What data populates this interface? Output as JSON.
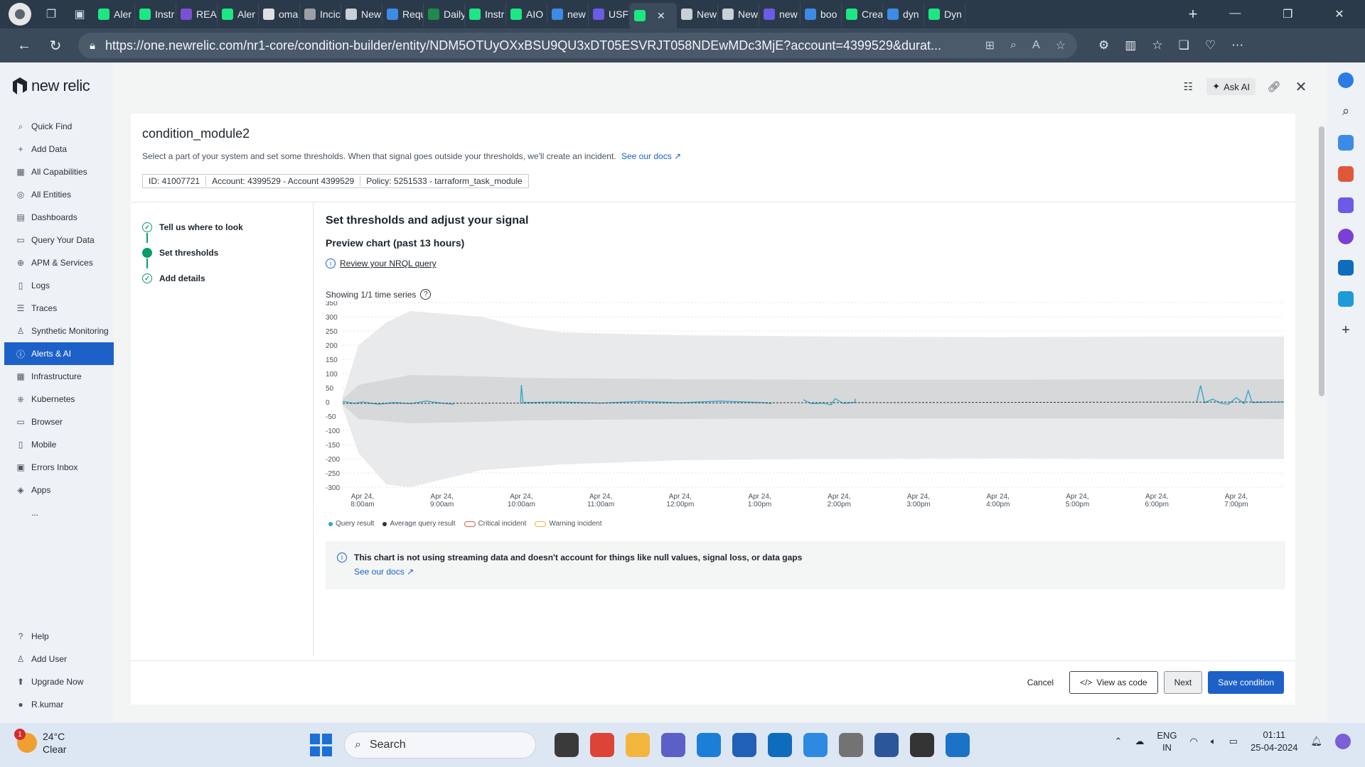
{
  "browser": {
    "tabs": [
      {
        "label": "Aler",
        "color": "#1ce783"
      },
      {
        "label": "Instr",
        "color": "#1ce783"
      },
      {
        "label": "REA",
        "color": "#7b4fd6"
      },
      {
        "label": "Aler",
        "color": "#1ce783"
      },
      {
        "label": "oma",
        "color": "#e0e0e0"
      },
      {
        "label": "Incic",
        "color": "#9aa0a6"
      },
      {
        "label": "New",
        "color": "#c9d0d6"
      },
      {
        "label": "Requ",
        "color": "#3c8ce7"
      },
      {
        "label": "Daily",
        "color": "#1e8a4c"
      },
      {
        "label": "Instr",
        "color": "#1ce783"
      },
      {
        "label": "AIO",
        "color": "#1ce783"
      },
      {
        "label": "new",
        "color": "#3c8ce7"
      },
      {
        "label": "USF",
        "color": "#6b5be6"
      },
      {
        "label": "",
        "color": "#1ce783",
        "active": true
      },
      {
        "label": "New",
        "color": "#c9d0d6"
      },
      {
        "label": "New",
        "color": "#c9d0d6"
      },
      {
        "label": "new",
        "color": "#6b5be6"
      },
      {
        "label": "boo",
        "color": "#3c8ce7"
      },
      {
        "label": "Crea",
        "color": "#1ce783"
      },
      {
        "label": "dyn",
        "color": "#3c8ce7"
      },
      {
        "label": "Dyn",
        "color": "#1ce783"
      }
    ],
    "url": "https://one.newrelic.com/nr1-core/condition-builder/entity/NDM5OTUyOXxBSU9QU3xDT05ESVRJT058NDEwMDc3MjE?account=4399529&durat..."
  },
  "nav": {
    "brand": "new relic",
    "items": [
      {
        "label": "Quick Find",
        "icon": "search-icon",
        "glyph": "⌕"
      },
      {
        "label": "Add Data",
        "icon": "plus-icon",
        "glyph": "+"
      },
      {
        "label": "All Capabilities",
        "icon": "grid-icon",
        "glyph": "▦"
      },
      {
        "label": "All Entities",
        "icon": "entities-icon",
        "glyph": "◎"
      },
      {
        "label": "Dashboards",
        "icon": "dashboard-icon",
        "glyph": "▤"
      },
      {
        "label": "Query Your Data",
        "icon": "query-icon",
        "glyph": "▭"
      },
      {
        "label": "APM & Services",
        "icon": "globe-icon",
        "glyph": "⊕"
      },
      {
        "label": "Logs",
        "icon": "logs-icon",
        "glyph": "▯"
      },
      {
        "label": "Traces",
        "icon": "traces-icon",
        "glyph": "☰"
      },
      {
        "label": "Synthetic Monitoring",
        "icon": "synthetic-icon",
        "glyph": "♙"
      },
      {
        "label": "Alerts & AI",
        "icon": "alert-icon",
        "glyph": "ⓘ",
        "active": true
      },
      {
        "label": "Infrastructure",
        "icon": "infrastructure-icon",
        "glyph": "▦"
      },
      {
        "label": "Kubernetes",
        "icon": "kubernetes-icon",
        "glyph": "⎈"
      },
      {
        "label": "Browser",
        "icon": "browser-icon",
        "glyph": "▭"
      },
      {
        "label": "Mobile",
        "icon": "mobile-icon",
        "glyph": "▯"
      },
      {
        "label": "Errors Inbox",
        "icon": "inbox-icon",
        "glyph": "▣"
      },
      {
        "label": "Apps",
        "icon": "apps-icon",
        "glyph": "◈"
      },
      {
        "label": "...",
        "icon": "more-icon",
        "glyph": ""
      }
    ],
    "bottom": [
      {
        "label": "Help",
        "icon": "help-icon",
        "glyph": "?"
      },
      {
        "label": "Add User",
        "icon": "add-user-icon",
        "glyph": "♙"
      },
      {
        "label": "Upgrade Now",
        "icon": "upgrade-icon",
        "glyph": "⬆"
      },
      {
        "label": "R.kumar",
        "icon": "user-icon",
        "glyph": "●"
      }
    ]
  },
  "toolbar": {
    "ask_ai": "Ask AI"
  },
  "condition": {
    "name": "condition_module2",
    "description": "Select a part of your system and set some thresholds. When that signal goes outside your thresholds, we'll create an incident.",
    "docs_link": "See our docs",
    "meta": [
      "ID: 41007721",
      "Account: 4399529 - Account 4399529",
      "Policy: 5251533 - tarraform_task_module"
    ]
  },
  "steps": [
    {
      "label": "Tell us where to look",
      "state": "done"
    },
    {
      "label": "Set thresholds",
      "state": "current"
    },
    {
      "label": "Add details",
      "state": "done"
    }
  ],
  "main": {
    "heading": "Set thresholds and adjust your signal",
    "preview": "Preview chart (past 13 hours)",
    "review": "Review your NRQL query",
    "showing": "Showing 1/1 time series"
  },
  "chart_data": {
    "type": "line",
    "ylim": [
      -300,
      350
    ],
    "yticks": [
      350,
      300,
      250,
      200,
      150,
      100,
      50,
      0,
      -50,
      -100,
      -150,
      -200,
      -250,
      -300
    ],
    "xticks": [
      [
        "Apr 24,",
        "8:00am"
      ],
      [
        "Apr 24,",
        "9:00am"
      ],
      [
        "Apr 24,",
        "10:00am"
      ],
      [
        "Apr 24,",
        "11:00am"
      ],
      [
        "Apr 24,",
        "12:00pm"
      ],
      [
        "Apr 24,",
        "1:00pm"
      ],
      [
        "Apr 24,",
        "2:00pm"
      ],
      [
        "Apr 24,",
        "3:00pm"
      ],
      [
        "Apr 24,",
        "4:00pm"
      ],
      [
        "Apr 24,",
        "5:00pm"
      ],
      [
        "Apr 24,",
        "6:00pm"
      ],
      [
        "Apr 24,",
        "7:00pm"
      ]
    ],
    "x_start_hour": 7.75,
    "x_end_hour": 19.6,
    "outer_band": [
      [
        7.75,
        -20,
        20
      ],
      [
        7.95,
        -180,
        200
      ],
      [
        8.3,
        -290,
        280
      ],
      [
        8.6,
        -300,
        320
      ],
      [
        9.5,
        -240,
        300
      ],
      [
        10.0,
        -230,
        265
      ],
      [
        10.5,
        -220,
        245
      ],
      [
        12,
        -205,
        235
      ],
      [
        14,
        -200,
        230
      ],
      [
        16,
        -198,
        228
      ],
      [
        18,
        -200,
        230
      ],
      [
        19.6,
        -200,
        230
      ]
    ],
    "inner_band": [
      [
        7.75,
        -10,
        10
      ],
      [
        7.95,
        -60,
        60
      ],
      [
        8.6,
        -75,
        95
      ],
      [
        9.5,
        -70,
        90
      ],
      [
        10,
        -65,
        85
      ],
      [
        12,
        -60,
        80
      ],
      [
        14,
        -58,
        78
      ],
      [
        16,
        -58,
        78
      ],
      [
        18,
        -58,
        80
      ],
      [
        19.6,
        -60,
        80
      ]
    ],
    "series": [
      {
        "name": "Query result",
        "color": "#2aa8c9",
        "segments": [
          [
            [
              7.75,
              2
            ],
            [
              7.9,
              -5
            ],
            [
              8,
              0
            ],
            [
              8.2,
              -8
            ],
            [
              8.4,
              -2
            ],
            [
              8.6,
              -6
            ],
            [
              8.8,
              3
            ],
            [
              9.0,
              -4
            ],
            [
              9.15,
              -8
            ]
          ],
          [
            [
              9.99,
              -2
            ],
            [
              10.0,
              60
            ],
            [
              10.02,
              -2
            ],
            [
              10.5,
              0
            ],
            [
              11,
              -4
            ],
            [
              11.5,
              2
            ],
            [
              12.0,
              -3
            ],
            [
              12.5,
              3
            ],
            [
              13.0,
              -2
            ],
            [
              13.15,
              -5
            ]
          ],
          [
            [
              13.55,
              8
            ],
            [
              13.65,
              -6
            ],
            [
              13.8,
              -4
            ],
            [
              13.9,
              -10
            ],
            [
              13.95,
              12
            ],
            [
              14.05,
              -5
            ],
            [
              14.2,
              -2
            ],
            [
              14.2,
              12
            ]
          ],
          [
            [
              18.5,
              -2
            ],
            [
              18.55,
              58
            ],
            [
              18.6,
              -3
            ],
            [
              18.7,
              10
            ],
            [
              18.8,
              -4
            ],
            [
              18.9,
              -8
            ],
            [
              19.0,
              15
            ],
            [
              19.1,
              -6
            ],
            [
              19.15,
              40
            ],
            [
              19.2,
              -2
            ],
            [
              19.6,
              0
            ]
          ]
        ]
      },
      {
        "name": "Average query result",
        "color": "#333333",
        "dashed": true,
        "segments": [
          [
            [
              7.75,
              -5
            ],
            [
              19.6,
              0
            ]
          ]
        ]
      }
    ],
    "legend": [
      {
        "label": "Query result",
        "kind": "dot",
        "color": "#2aa8c9"
      },
      {
        "label": "Average query result",
        "kind": "dot",
        "color": "#333333"
      },
      {
        "label": "Critical incident",
        "kind": "toggle",
        "color": "#e05a4f"
      },
      {
        "label": "Warning incident",
        "kind": "toggle",
        "color": "#f0b43c"
      }
    ]
  },
  "notice": {
    "text": "This chart is not using streaming data and doesn't account for things like null values, signal loss, or data gaps",
    "link": "See our docs"
  },
  "footer": {
    "cancel": "Cancel",
    "view_code": "View as code",
    "next": "Next",
    "save": "Save condition"
  },
  "taskbar": {
    "temp": "24°C",
    "condition": "Clear",
    "badge": "1",
    "search": "Search",
    "lang1": "ENG",
    "lang2": "IN",
    "time": "01:11",
    "date": "25-04-2024",
    "apps": [
      "#3a3a3a",
      "#db4437",
      "#f2b63c",
      "#5b5fc7",
      "#1b7fd8",
      "#2160b8",
      "#0f6cbd",
      "#2d8ae0",
      "#737373",
      "#2b579a",
      "#333333",
      "#1a73c7"
    ]
  }
}
